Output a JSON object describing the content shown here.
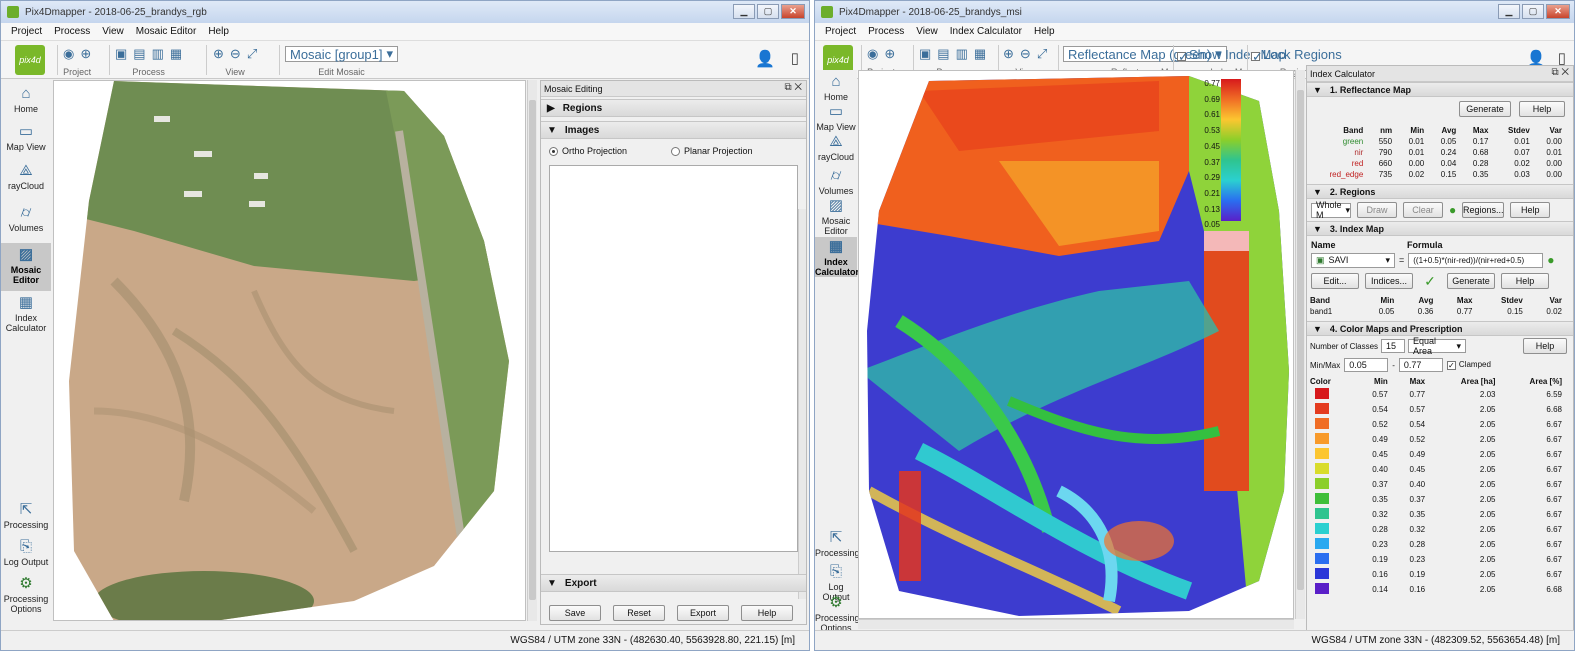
{
  "left_window": {
    "title": "Pix4Dmapper - 2018-06-25_brandys_rgb",
    "menu": [
      "Project",
      "Process",
      "View",
      "Mosaic Editor",
      "Help"
    ],
    "logo_text": "pix4d",
    "toolbar_groups": [
      "Project",
      "Process",
      "View",
      "Edit Mosaic"
    ],
    "mosaic_combo": "Mosaic [group1]",
    "sidebar": [
      {
        "label": "Home",
        "icon": "home-icon"
      },
      {
        "label": "Map View",
        "icon": "map-icon"
      },
      {
        "label": "rayCloud",
        "icon": "raycloud-icon"
      },
      {
        "label": "Volumes",
        "icon": "volumes-icon"
      },
      {
        "label": "Mosaic Editor",
        "icon": "mosaic-editor-icon",
        "active": true
      },
      {
        "label": "Index Calculator",
        "icon": "index-calculator-icon"
      },
      {
        "label": "Processing",
        "icon": "processing-icon"
      },
      {
        "label": "Log Output",
        "icon": "log-output-icon"
      },
      {
        "label": "Processing Options",
        "icon": "gear-icon"
      }
    ],
    "panel": {
      "title": "Mosaic Editing",
      "regions": "Regions",
      "images": "Images",
      "ortho": "Ortho Projection",
      "planar": "Planar Projection",
      "export": "Export",
      "buttons": [
        "Save",
        "Reset",
        "Export",
        "Help"
      ]
    },
    "status": "WGS84 / UTM zone 33N - (482630.40, 5563928.80, 221.15) [m]"
  },
  "right_window": {
    "title": "Pix4Dmapper - 2018-06-25_brandys_msi",
    "menu": [
      "Project",
      "Process",
      "View",
      "Index Calculator",
      "Help"
    ],
    "logo_text": "pix4d",
    "toolbar_groups": [
      "Project",
      "Process",
      "View",
      "Reflectance Map",
      "Index Map",
      "Regions"
    ],
    "reflectance_combo": "Reflectance Map (green)",
    "show_index_map": "Show Index Map",
    "lock_regions": "Lock Regions",
    "sidebar": [
      {
        "label": "Home",
        "icon": "home-icon"
      },
      {
        "label": "Map View",
        "icon": "map-icon"
      },
      {
        "label": "rayCloud",
        "icon": "raycloud-icon"
      },
      {
        "label": "Volumes",
        "icon": "volumes-icon"
      },
      {
        "label": "Mosaic Editor",
        "icon": "mosaic-editor-icon"
      },
      {
        "label": "Index Calculator",
        "icon": "index-calculator-icon",
        "active": true
      },
      {
        "label": "Processing",
        "icon": "processing-icon"
      },
      {
        "label": "Log Output",
        "icon": "log-output-icon"
      },
      {
        "label": "Processing Options",
        "icon": "gear-icon"
      }
    ],
    "legend_ticks": [
      "0.77",
      "0.69",
      "0.61",
      "0.53",
      "0.45",
      "0.37",
      "0.29",
      "0.21",
      "0.13",
      "0.05"
    ],
    "panel": {
      "title": "Index Calculator",
      "s1": "1. Reflectance Map",
      "generate": "Generate",
      "help": "Help",
      "band_headers": [
        "Band",
        "nm",
        "Min",
        "Avg",
        "Max",
        "Stdev",
        "Var"
      ],
      "bands": [
        {
          "band": "green",
          "color": "#2e8b2e",
          "nm": "550",
          "min": "0.01",
          "avg": "0.05",
          "max": "0.17",
          "stdev": "0.01",
          "var": "0.00"
        },
        {
          "band": "nir",
          "color": "#b03030",
          "nm": "790",
          "min": "0.01",
          "avg": "0.24",
          "max": "0.68",
          "stdev": "0.07",
          "var": "0.01"
        },
        {
          "band": "red",
          "color": "#c02020",
          "nm": "660",
          "min": "0.00",
          "avg": "0.04",
          "max": "0.28",
          "stdev": "0.02",
          "var": "0.00"
        },
        {
          "band": "red_edge",
          "color": "#c02020",
          "nm": "735",
          "min": "0.02",
          "avg": "0.15",
          "max": "0.35",
          "stdev": "0.03",
          "var": "0.00"
        }
      ],
      "s2": "2. Regions",
      "region_combo": "Whole M",
      "draw": "Draw",
      "clear": "Clear",
      "regions_btn": "Regions...",
      "s3": "3. Index Map",
      "name_label": "Name",
      "formula_label": "Formula",
      "index_name": "SAVI",
      "formula": "((1+0.5)*(nir-red))/(nir+red+0.5)",
      "edit": "Edit...",
      "indices": "Indices...",
      "index_headers": [
        "Band",
        "Min",
        "Avg",
        "Max",
        "Stdev",
        "Var"
      ],
      "index_row": {
        "band": "band1",
        "min": "0.05",
        "avg": "0.36",
        "max": "0.77",
        "stdev": "0.15",
        "var": "0.02"
      },
      "s4": "4. Color Maps and Prescription",
      "num_classes_label": "Number of Classes",
      "num_classes": "15",
      "classing": "Equal Area",
      "minmax_label": "Min/Max",
      "min_val": "0.05",
      "max_val": "0.77",
      "clamped": "Clamped",
      "class_headers": [
        "Color",
        "Min",
        "Max",
        "Area [ha]",
        "Area [%]"
      ],
      "classes": [
        {
          "color": "#d7191c",
          "min": "0.57",
          "max": "0.77",
          "ha": "2.03",
          "pct": "6.59"
        },
        {
          "color": "#e43b1f",
          "min": "0.54",
          "max": "0.57",
          "ha": "2.05",
          "pct": "6.68"
        },
        {
          "color": "#f06d25",
          "min": "0.52",
          "max": "0.54",
          "ha": "2.05",
          "pct": "6.67"
        },
        {
          "color": "#f89a2a",
          "min": "0.49",
          "max": "0.52",
          "ha": "2.05",
          "pct": "6.67"
        },
        {
          "color": "#fcc630",
          "min": "0.45",
          "max": "0.49",
          "ha": "2.05",
          "pct": "6.67"
        },
        {
          "color": "#d9dc2b",
          "min": "0.40",
          "max": "0.45",
          "ha": "2.05",
          "pct": "6.67"
        },
        {
          "color": "#8ccf2a",
          "min": "0.37",
          "max": "0.40",
          "ha": "2.05",
          "pct": "6.67"
        },
        {
          "color": "#3fbf3a",
          "min": "0.35",
          "max": "0.37",
          "ha": "2.05",
          "pct": "6.67"
        },
        {
          "color": "#2fc48f",
          "min": "0.32",
          "max": "0.35",
          "ha": "2.05",
          "pct": "6.67"
        },
        {
          "color": "#2bd0d0",
          "min": "0.28",
          "max": "0.32",
          "ha": "2.05",
          "pct": "6.67"
        },
        {
          "color": "#2aa9f0",
          "min": "0.23",
          "max": "0.28",
          "ha": "2.05",
          "pct": "6.67"
        },
        {
          "color": "#2a6ef0",
          "min": "0.19",
          "max": "0.23",
          "ha": "2.05",
          "pct": "6.67"
        },
        {
          "color": "#2b37d8",
          "min": "0.16",
          "max": "0.19",
          "ha": "2.05",
          "pct": "6.67"
        },
        {
          "color": "#5a1fc8",
          "min": "0.14",
          "max": "0.16",
          "ha": "2.05",
          "pct": "6.68"
        }
      ]
    },
    "status": "WGS84 / UTM zone 33N - (482309.52, 5563654.48) [m]"
  }
}
